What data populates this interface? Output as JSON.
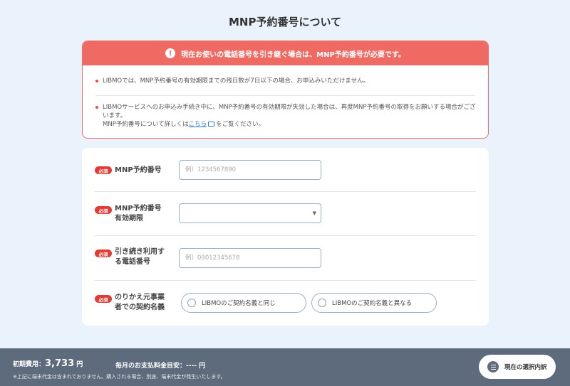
{
  "page": {
    "title": "MNP予約番号について"
  },
  "alert": {
    "heading": "現在お使いの電話番号を引き継ぐ場合は、MNP予約番号が必要です。",
    "item1": "LIBMOでは、MNP予約番号の有効期限までの残日数が7日以下の場合、お申込みいただけません。",
    "item2_line1": "LIBMOサービスへのお申込み手続き中に、MNP予約番号の有効期限が失効した場合は、再度MNP予約番号の取得をお願いする場合がございます。",
    "item2_line2_prefix": "MNP予約番号について詳しくは",
    "item2_link": "こちら",
    "item2_line2_suffix": "をご覧ください。"
  },
  "form": {
    "required_label": "必須",
    "mnp_number": {
      "label": "MNP予約番号",
      "placeholder": "例）1234567890",
      "value": ""
    },
    "mnp_expiry": {
      "label_line1": "MNP予約番号",
      "label_line2": "有効期限",
      "selected": ""
    },
    "phone_number": {
      "label_line1": "引き続き利用す",
      "label_line2": "る電話番号",
      "placeholder": "例）09012345678",
      "value": ""
    },
    "contract_name": {
      "label_line1": "のりかえ元事業",
      "label_line2": "者での契約名義",
      "options": [
        "LIBMOのご契約名義と同じ",
        "LIBMOのご契約名義と異なる"
      ]
    }
  },
  "footer": {
    "initial_label": "初期費用：",
    "initial_amount": "3,733",
    "yen": "円",
    "monthly_label": "毎月のお支払料金目安：---- 円",
    "note": "※上記に端末代金は含まれておりません。購入される場合、別途、端末代金が発生いたします。",
    "selection_button": "現在の選択内訳"
  },
  "colors": {
    "accent_red": "#f06a64",
    "required_red": "#e23b36",
    "footer_bg": "#5d6b7c",
    "link": "#2a7bd5"
  },
  "icons": [
    "exclamation-icon",
    "external-link-icon",
    "chevron-down-icon",
    "list-icon"
  ]
}
